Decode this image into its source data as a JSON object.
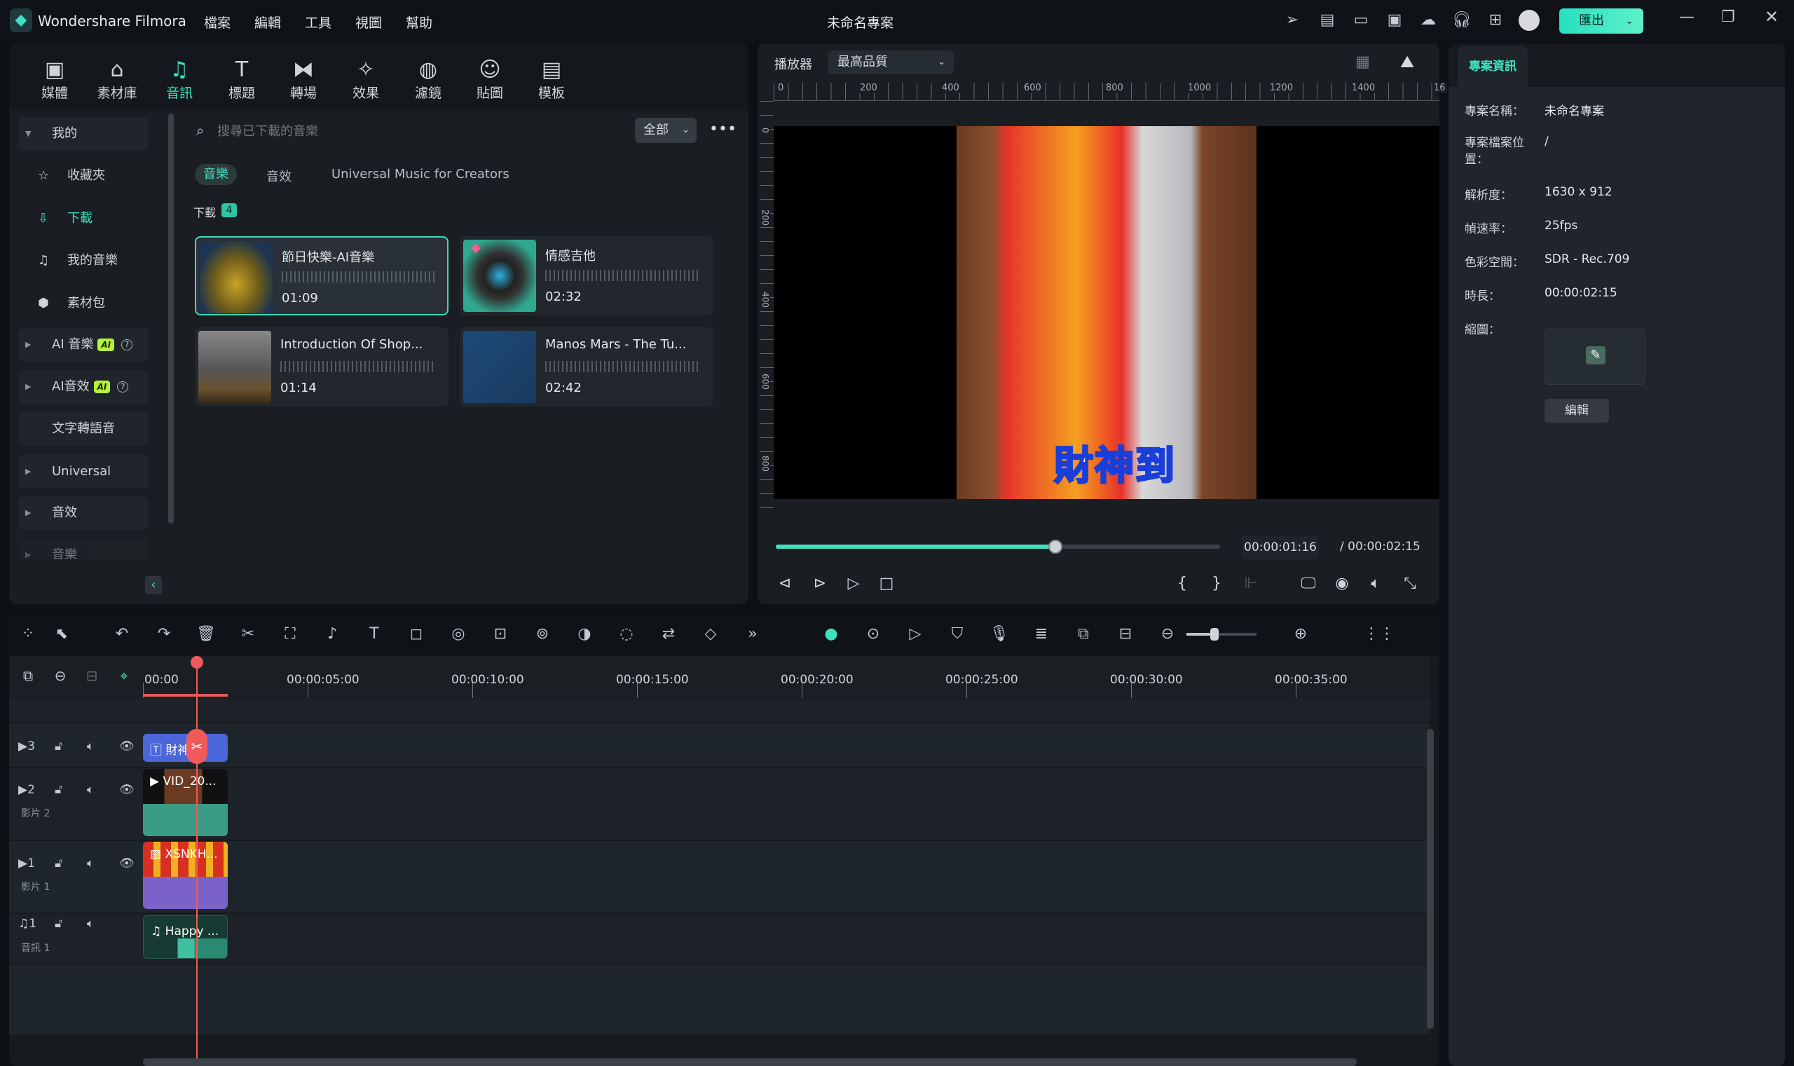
{
  "app": {
    "title": "Wondershare Filmora",
    "project_title": "未命名專案",
    "export_label": "匯出",
    "menu": [
      "檔案",
      "編輯",
      "工具",
      "視圖",
      "幫助"
    ],
    "title_icons": [
      "send-icon",
      "task-icon",
      "layout-icon",
      "save-icon",
      "cloud-icon",
      "headset-icon",
      "apps-icon",
      "avatar"
    ]
  },
  "media_toolbar": [
    {
      "label": "媒體",
      "icon": "media-icon"
    },
    {
      "label": "素材庫",
      "icon": "stock-icon"
    },
    {
      "label": "音訊",
      "icon": "music-icon",
      "active": true
    },
    {
      "label": "標題",
      "icon": "title-icon"
    },
    {
      "label": "轉場",
      "icon": "transition-icon"
    },
    {
      "label": "效果",
      "icon": "effects-icon"
    },
    {
      "label": "濾鏡",
      "icon": "filter-icon"
    },
    {
      "label": "貼圖",
      "icon": "sticker-icon"
    },
    {
      "label": "模板",
      "icon": "template-icon"
    }
  ],
  "sidebar": {
    "items": [
      {
        "label": "我的"
      },
      {
        "label": "收藏夾"
      },
      {
        "label": "下載",
        "active": true
      },
      {
        "label": "我的音樂"
      },
      {
        "label": "素材包"
      },
      {
        "label": "AI 音樂",
        "badge": "AI"
      },
      {
        "label": "AI音效",
        "badge": "AI"
      },
      {
        "label": "文字轉語音"
      },
      {
        "label": "Universal Mus..."
      },
      {
        "label": "音效"
      },
      {
        "label": "音樂"
      }
    ]
  },
  "library": {
    "search_placeholder": "搜尋已下載的音樂",
    "filter": "全部",
    "tabs": [
      "音樂",
      "音效",
      "Universal Music for Creators"
    ],
    "section": "下載",
    "count": "4",
    "cards": [
      {
        "title": "節日快樂-AI音樂",
        "duration": "01:09"
      },
      {
        "title": "情感吉他",
        "duration": "02:32"
      },
      {
        "title": "Introduction Of Shop...",
        "duration": "01:14"
      },
      {
        "title": "Manos Mars - The Tu...",
        "duration": "02:42"
      }
    ]
  },
  "player": {
    "label": "播放器",
    "quality": "最高品質",
    "ruler_x": [
      "0",
      "200",
      "400",
      "600",
      "800",
      "1000",
      "1200",
      "1400",
      "16"
    ],
    "ruler_y": [
      "0",
      "200",
      "400",
      "600",
      "800"
    ],
    "caption": "財神到",
    "current_time": "00:00:01:16",
    "total_time": "/ 00:00:02:15",
    "progress": 0.63
  },
  "project_info": {
    "tab": "專案資訊",
    "rows": [
      {
        "label": "專案名稱：",
        "value": "未命名專案"
      },
      {
        "label": "專案檔案位置：",
        "value": "/"
      },
      {
        "label": "解析度：",
        "value": "1630 x 912"
      },
      {
        "label": "幀速率：",
        "value": "25fps"
      },
      {
        "label": "色彩空間：",
        "value": "SDR - Rec.709"
      },
      {
        "label": "時長：",
        "value": "00:00:02:15"
      },
      {
        "label": "縮圖：",
        "value": ""
      }
    ],
    "edit_label": "編輯"
  },
  "timeline": {
    "ruler": [
      "00:00",
      "00:00:05:00",
      "00:00:10:00",
      "00:00:15:00",
      "00:00:20:00",
      "00:00:25:00",
      "00:00:30:00",
      "00:00:35:00"
    ],
    "zoom_level": 0.4,
    "tracks": [
      {
        "num": "3",
        "name": "",
        "clip": "財神到"
      },
      {
        "num": "2",
        "name": "影片 2",
        "clip": "VID_20..."
      },
      {
        "num": "1",
        "name": "影片 1",
        "clip": "XSNKH..."
      },
      {
        "num": "1",
        "name": "音訊 1",
        "clip": "Happy ..."
      }
    ]
  }
}
